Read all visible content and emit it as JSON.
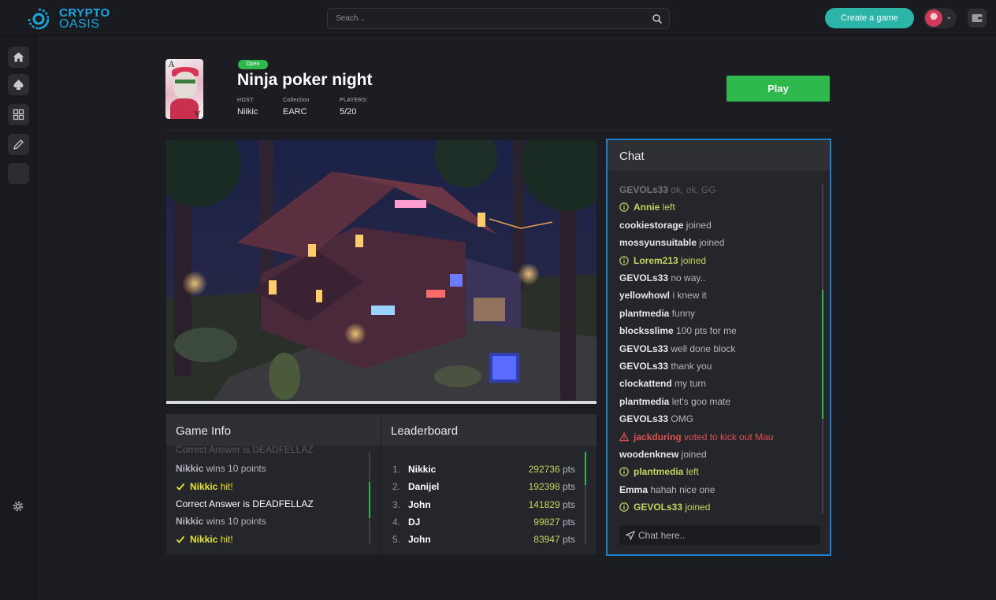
{
  "brand": {
    "line1": "CRYPTO",
    "line2": "OASIS",
    "color": "#1aa7e0"
  },
  "search": {
    "placeholder": "Seach...",
    "icon": "search-icon"
  },
  "topbar": {
    "create_label": "Create a game",
    "wallet_icon": "wallet-icon"
  },
  "sidebar": {
    "items": [
      {
        "name": "home",
        "icon": "home-icon"
      },
      {
        "name": "cards",
        "icon": "spade-icon"
      },
      {
        "name": "grid",
        "icon": "grid-icon"
      },
      {
        "name": "edit",
        "icon": "pencil-icon"
      },
      {
        "name": "blank",
        "icon": ""
      }
    ],
    "settings_icon": "gear-icon"
  },
  "game": {
    "status": "Open",
    "title": "Ninja poker night",
    "host_label": "HOST:",
    "host": "Niikic",
    "collection_label": "Collection",
    "collection": "EARC",
    "players_label": "PLAYERS:",
    "players": "5/20",
    "play_label": "Play",
    "thumb_card_rank": "A",
    "thumb_card_rank_bottom": "A",
    "progress": 1.0
  },
  "game_info": {
    "title": "Game Info",
    "lines": [
      {
        "prefix": "",
        "name": "",
        "text": "Correct Answer is DEADFELLAZ",
        "style": "faded"
      },
      {
        "prefix": "",
        "name": "Nikkic",
        "text": " wins 10 points",
        "style": "gray"
      },
      {
        "prefix": "check",
        "name": "Nikkic",
        "text": " hit!",
        "style": "hit"
      },
      {
        "prefix": "",
        "name": "",
        "text": "Correct Answer is DEADFELLAZ",
        "style": "white"
      },
      {
        "prefix": "",
        "name": "Nikkic",
        "text": " wins 10 points",
        "style": "gray"
      },
      {
        "prefix": "check",
        "name": "Nikkic",
        "text": " hit!",
        "style": "hit"
      }
    ]
  },
  "leaderboard": {
    "title": "Leaderboard",
    "rows": [
      {
        "rank": "1.",
        "name": "Nikkic",
        "score": "292736",
        "unit": " pts"
      },
      {
        "rank": "2.",
        "name": "Danijel",
        "score": "192398",
        "unit": " pts"
      },
      {
        "rank": "3.",
        "name": "John",
        "score": "141829",
        "unit": " pts"
      },
      {
        "rank": "4.",
        "name": "DJ",
        "score": "99827",
        "unit": " pts"
      },
      {
        "rank": "5.",
        "name": "John",
        "score": "83947",
        "unit": " pts"
      }
    ]
  },
  "chat": {
    "title": "Chat",
    "placeholder": "Chat here..",
    "messages": [
      {
        "user": "GEVOLs33",
        "text": " ok, ok, GG",
        "kind": "faded"
      },
      {
        "user": "Annie",
        "text": " left",
        "kind": "info"
      },
      {
        "user": "cookiestorage",
        "text": " joined",
        "kind": "normal"
      },
      {
        "user": "mossyunsuitable",
        "text": " joined",
        "kind": "normal"
      },
      {
        "user": "Lorem213",
        "text": " joined",
        "kind": "info"
      },
      {
        "user": "GEVOLs33",
        "text": " no way..",
        "kind": "normal"
      },
      {
        "user": "yellowhowl",
        "text": " i knew it",
        "kind": "normal"
      },
      {
        "user": "plantmedia",
        "text": " funny",
        "kind": "normal"
      },
      {
        "user": "blocksslime",
        "text": " 100 pts for me",
        "kind": "normal"
      },
      {
        "user": "GEVOLs33",
        "text": " well done block",
        "kind": "normal"
      },
      {
        "user": "GEVOLs33",
        "text": " thank you",
        "kind": "normal"
      },
      {
        "user": "clockattend",
        "text": " my turn",
        "kind": "normal"
      },
      {
        "user": "plantmedia",
        "text": " let's goo mate",
        "kind": "normal"
      },
      {
        "user": "GEVOLs33",
        "text": " OMG",
        "kind": "normal"
      },
      {
        "user": "jackduring",
        "text": " voted to kick out Mau",
        "kind": "warn"
      },
      {
        "user": "woodenknew",
        "text": " joined",
        "kind": "normal"
      },
      {
        "user": "plantmedia",
        "text": " left",
        "kind": "info"
      },
      {
        "user": "Emma",
        "text": " hahah nice one",
        "kind": "normal"
      },
      {
        "user": "GEVOLs33",
        "text": " joined",
        "kind": "info"
      }
    ]
  },
  "colors": {
    "accent_green": "#2fb84c",
    "accent_teal": "#2bb5a8",
    "chat_border": "#1f7fcf",
    "score_green": "#c5d35e",
    "hit_yellow": "#e8e52a",
    "warn_red": "#e0504f"
  }
}
